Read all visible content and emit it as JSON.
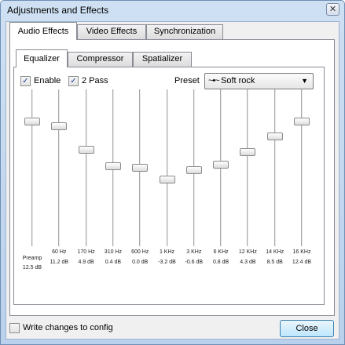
{
  "window": {
    "title": "Adjustments and Effects",
    "close_glyph": "✕"
  },
  "tabs": [
    {
      "label": "Audio Effects",
      "active": true
    },
    {
      "label": "Video Effects",
      "active": false
    },
    {
      "label": "Synchronization",
      "active": false
    }
  ],
  "subtabs": [
    {
      "label": "Equalizer",
      "active": true
    },
    {
      "label": "Compressor",
      "active": false
    },
    {
      "label": "Spatializer",
      "active": false
    }
  ],
  "equalizer": {
    "enable": {
      "label": "Enable",
      "checked": true
    },
    "two_pass": {
      "label": "2 Pass",
      "checked": true
    },
    "preset": {
      "label": "Preset",
      "value": "Soft rock",
      "icon": "~•~"
    },
    "preamp": {
      "label": "Preamp",
      "value": "12.5 dB",
      "level": 12.5
    },
    "bands": [
      {
        "freq": "60 Hz",
        "value": "11.2 dB",
        "level": 11.2
      },
      {
        "freq": "170 Hz",
        "value": "4.9 dB",
        "level": 4.9
      },
      {
        "freq": "310 Hz",
        "value": "0.4 dB",
        "level": 0.4
      },
      {
        "freq": "600 Hz",
        "value": "0.0 dB",
        "level": 0.0
      },
      {
        "freq": "1 KHz",
        "value": "-3.2 dB",
        "level": -3.2
      },
      {
        "freq": "3 KHz",
        "value": "-0.6 dB",
        "level": -0.6
      },
      {
        "freq": "6 KHz",
        "value": "0.8 dB",
        "level": 0.8
      },
      {
        "freq": "12 KHz",
        "value": "4.3 dB",
        "level": 4.3
      },
      {
        "freq": "14 KHz",
        "value": "8.5 dB",
        "level": 8.5
      },
      {
        "freq": "16 KHz",
        "value": "12.4 dB",
        "level": 12.4
      }
    ]
  },
  "footer": {
    "write_config": {
      "label": "Write changes to config",
      "checked": false
    },
    "close_label": "Close"
  }
}
